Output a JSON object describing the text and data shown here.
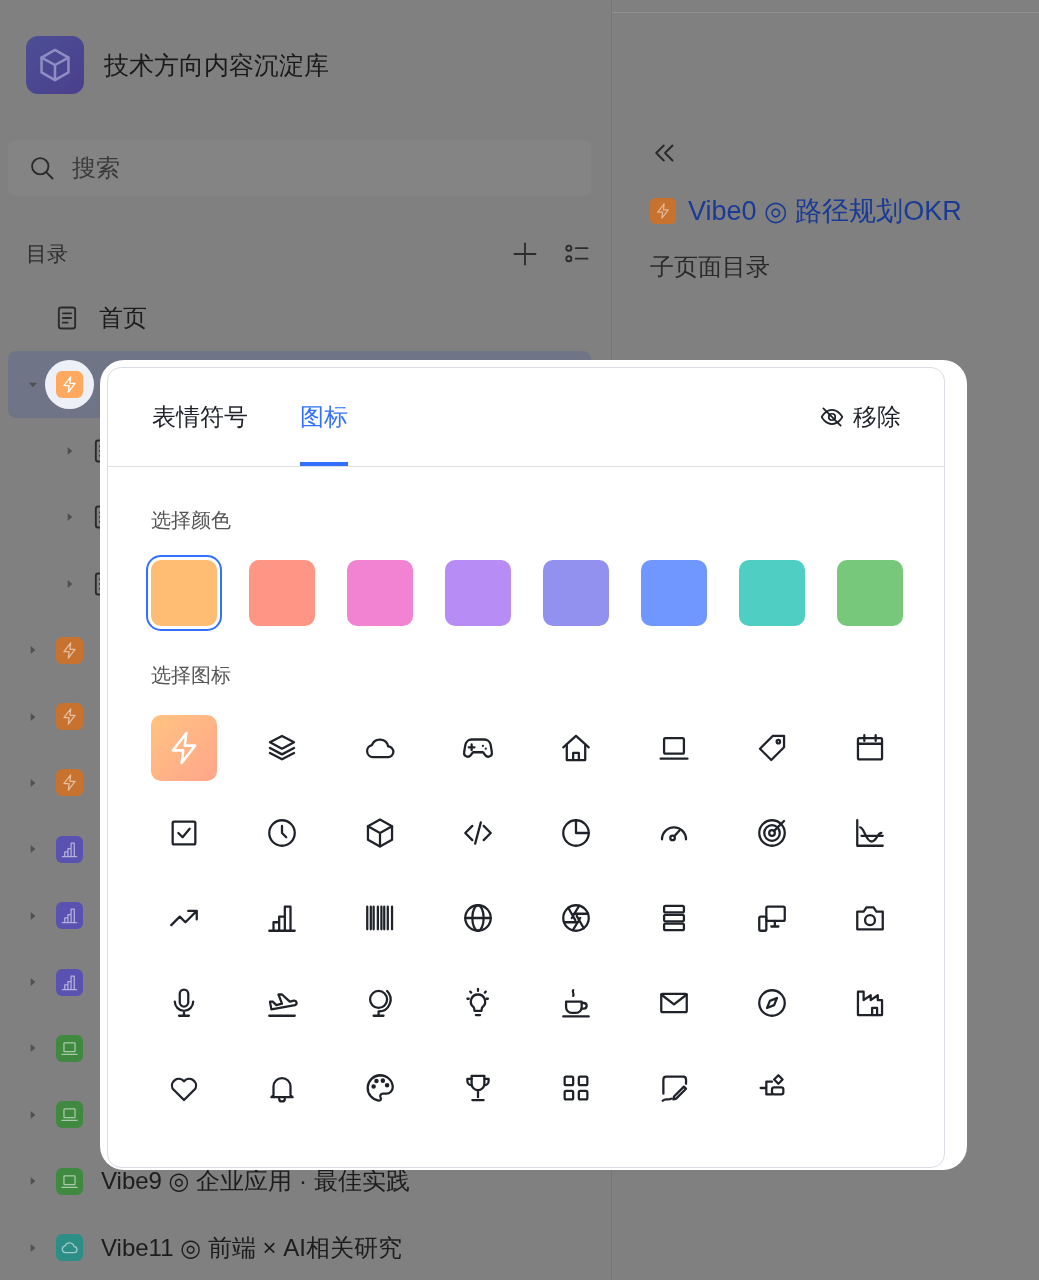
{
  "sidebar": {
    "title": "技术方向内容沉淀库",
    "search": {
      "placeholder": "搜索"
    },
    "section_label": "目录",
    "tree": [
      {
        "kind": "page",
        "label": "首页",
        "selected": false
      },
      {
        "kind": "bolt",
        "color": "#ffa860",
        "selected": true,
        "expanded": true,
        "icon_editing": true,
        "children": [
          {
            "kind": "page",
            "selected": false,
            "expanded": false
          },
          {
            "kind": "page",
            "selected": false,
            "expanded": false
          },
          {
            "kind": "page",
            "selected": false,
            "expanded": false
          }
        ]
      },
      {
        "kind": "bolt",
        "color": "#c8722f",
        "selected": false,
        "expanded": false,
        "icon_editing": false
      },
      {
        "kind": "bolt",
        "color": "#c8722f",
        "selected": false,
        "expanded": false,
        "icon_editing": false
      },
      {
        "kind": "bolt",
        "color": "#c8722f",
        "selected": false,
        "expanded": false,
        "icon_editing": false
      },
      {
        "kind": "chart",
        "color": "#5a52b0",
        "selected": false,
        "expanded": false,
        "icon_editing": false
      },
      {
        "kind": "chart",
        "color": "#5a52b0",
        "selected": false,
        "expanded": false,
        "icon_editing": false
      },
      {
        "kind": "chart",
        "color": "#5a52b0",
        "selected": false,
        "expanded": false,
        "icon_editing": false
      },
      {
        "kind": "laptop",
        "color": "#3f8a40",
        "selected": false,
        "expanded": false,
        "icon_editing": false
      },
      {
        "kind": "laptop",
        "color": "#3f8a40",
        "selected": false,
        "expanded": false,
        "icon_editing": false
      },
      {
        "kind": "laptop",
        "color": "#3f8a40",
        "label": "Vibe9 ◎ 企业应用 · 最佳实践",
        "selected": false,
        "expanded": false,
        "icon_editing": false
      },
      {
        "kind": "cloud",
        "color": "#2c8e86",
        "label": "Vibe11 ◎ 前端 × AI相关研究",
        "selected": false,
        "expanded": false,
        "icon_editing": false
      }
    ]
  },
  "page": {
    "title": "Vibe0 ◎ 路径规划OKR",
    "subtitle": "子页面目录"
  },
  "icon_picker": {
    "tabs": [
      {
        "label": "表情符号",
        "selected": false
      },
      {
        "label": "图标",
        "selected": true
      }
    ],
    "remove_label": "移除",
    "color_label": "选择颜色",
    "colors": [
      {
        "color": "#ffbd73",
        "selected": true
      },
      {
        "color": "#ff9585",
        "selected": false
      },
      {
        "color": "#f283d2",
        "selected": false
      },
      {
        "color": "#b88cf5",
        "selected": false
      },
      {
        "color": "#9291ef",
        "selected": false
      },
      {
        "color": "#6f97ff",
        "selected": false
      },
      {
        "color": "#4fcfc4",
        "selected": false
      },
      {
        "color": "#77c87a",
        "selected": false
      }
    ],
    "icon_label": "选择图标",
    "icons": [
      {
        "selected": true
      },
      {
        "selected": false
      },
      {
        "selected": false
      },
      {
        "selected": false
      },
      {
        "selected": false
      },
      {
        "selected": false
      },
      {
        "selected": false
      },
      {
        "selected": false
      },
      {
        "selected": false
      },
      {
        "selected": false
      },
      {
        "selected": false
      },
      {
        "selected": false
      },
      {
        "selected": false
      },
      {
        "selected": false
      },
      {
        "selected": false
      },
      {
        "selected": false
      },
      {
        "selected": false
      },
      {
        "selected": false
      },
      {
        "selected": false
      },
      {
        "selected": false
      },
      {
        "selected": false
      },
      {
        "selected": false
      },
      {
        "selected": false
      },
      {
        "selected": false
      },
      {
        "selected": false
      },
      {
        "selected": false
      },
      {
        "selected": false
      },
      {
        "selected": false
      },
      {
        "selected": false
      },
      {
        "selected": false
      },
      {
        "selected": false
      },
      {
        "selected": false
      },
      {
        "selected": false
      },
      {
        "selected": false
      },
      {
        "selected": false
      },
      {
        "selected": false
      },
      {
        "selected": false
      },
      {
        "selected": false
      },
      {
        "selected": false
      }
    ]
  }
}
